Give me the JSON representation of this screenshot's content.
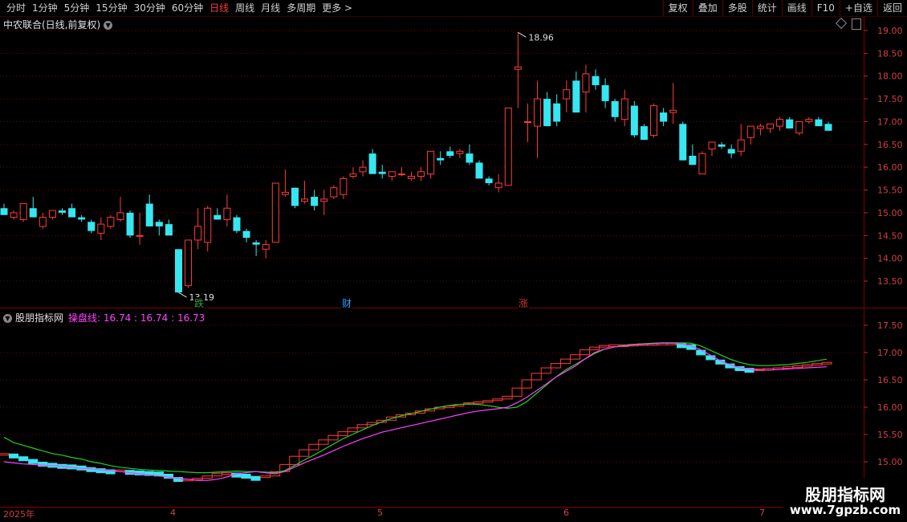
{
  "toolbar": {
    "periods": [
      "分时",
      "1分钟",
      "5分钟",
      "15分钟",
      "30分钟",
      "60分钟",
      "日线",
      "周线",
      "月线",
      "多周期",
      "更多 >"
    ],
    "active_period": "日线",
    "actions": [
      "复权",
      "叠加",
      "多股",
      "统计",
      "画线",
      "F10",
      "+自选",
      "返回"
    ]
  },
  "main_chart": {
    "title": "中农联合(日线,前复权)",
    "price_labels": [
      "19.00",
      "18.50",
      "18.00",
      "17.50",
      "17.00",
      "16.50",
      "16.00",
      "15.50",
      "15.00",
      "14.50",
      "14.00",
      "13.50"
    ],
    "high_label": "18.96",
    "low_label": "13.19",
    "markers": [
      {
        "text": "跌",
        "color": "#3c9c3c"
      },
      {
        "text": "财",
        "color": "#2aa0ff"
      },
      {
        "text": "涨",
        "color": "#d03030"
      }
    ]
  },
  "indicator": {
    "name": "股朋指标网",
    "line_name": "操盘线:",
    "values": "16.74 : 16.74 : 16.73",
    "price_labels": [
      "17.50",
      "17.00",
      "16.50",
      "16.00",
      "15.50",
      "15.00"
    ]
  },
  "date_axis": [
    "2025年",
    "4",
    "5",
    "6",
    "7"
  ],
  "watermark": {
    "line1": "股朋指标网",
    "line2": "www.7gpzb.com"
  },
  "colors": {
    "up": "#ff3b3b",
    "down": "#36e6f0",
    "ma_green": "#20d020",
    "ma_magenta": "#ff40ff",
    "grid": "#7a0000"
  },
  "chart_data": [
    {
      "type": "candlestick",
      "title": "中农联合(日线,前复权)",
      "ylim": [
        13.0,
        19.2
      ],
      "candles": [
        [
          15.1,
          15.2,
          14.95,
          14.95
        ],
        [
          14.9,
          15.05,
          14.85,
          15.0
        ],
        [
          14.85,
          15.2,
          14.8,
          15.2
        ],
        [
          15.1,
          15.35,
          14.9,
          14.9
        ],
        [
          14.7,
          15.0,
          14.65,
          14.9
        ],
        [
          14.9,
          15.05,
          14.85,
          15.05
        ],
        [
          15.05,
          15.1,
          14.95,
          15.0
        ],
        [
          15.1,
          15.2,
          14.95,
          14.9
        ],
        [
          14.9,
          14.95,
          14.8,
          14.85
        ],
        [
          14.8,
          14.85,
          14.55,
          14.6
        ],
        [
          14.55,
          14.9,
          14.4,
          14.75
        ],
        [
          14.7,
          14.95,
          14.65,
          14.9
        ],
        [
          14.85,
          15.35,
          14.8,
          15.0
        ],
        [
          15.0,
          15.05,
          14.45,
          14.5
        ],
        [
          14.5,
          15.0,
          14.3,
          14.5
        ],
        [
          15.2,
          15.4,
          14.8,
          14.7
        ],
        [
          14.8,
          14.85,
          14.5,
          14.7
        ],
        [
          14.75,
          14.85,
          14.55,
          14.5
        ],
        [
          14.2,
          14.2,
          13.25,
          13.25
        ],
        [
          13.4,
          14.4,
          13.35,
          14.4
        ],
        [
          14.4,
          15.1,
          14.2,
          14.7
        ],
        [
          14.35,
          15.15,
          14.15,
          15.1
        ],
        [
          14.95,
          15.1,
          14.85,
          14.85
        ],
        [
          14.85,
          15.4,
          14.7,
          15.1
        ],
        [
          14.9,
          14.95,
          14.55,
          14.6
        ],
        [
          14.6,
          14.65,
          14.35,
          14.45
        ],
        [
          14.35,
          14.4,
          14.05,
          14.3
        ],
        [
          14.2,
          14.4,
          14.0,
          14.3
        ],
        [
          14.35,
          15.6,
          14.35,
          15.65
        ],
        [
          15.4,
          15.95,
          15.35,
          15.45
        ],
        [
          15.55,
          15.55,
          15.1,
          15.15
        ],
        [
          15.25,
          15.7,
          15.2,
          15.3
        ],
        [
          15.35,
          15.5,
          15.05,
          15.15
        ],
        [
          15.25,
          15.5,
          14.95,
          15.3
        ],
        [
          15.35,
          15.6,
          15.3,
          15.55
        ],
        [
          15.4,
          15.8,
          15.3,
          15.75
        ],
        [
          15.8,
          16.0,
          15.75,
          15.85
        ],
        [
          15.9,
          16.15,
          15.8,
          16.0
        ],
        [
          16.3,
          16.4,
          15.9,
          15.85
        ],
        [
          15.9,
          16.05,
          15.75,
          15.85
        ],
        [
          15.8,
          15.9,
          15.7,
          15.9
        ],
        [
          15.85,
          16.0,
          15.8,
          15.85
        ],
        [
          15.75,
          15.9,
          15.7,
          15.8
        ],
        [
          15.8,
          16.0,
          15.7,
          15.9
        ],
        [
          15.85,
          16.15,
          15.75,
          16.35
        ],
        [
          16.2,
          16.35,
          16.05,
          16.15
        ],
        [
          16.35,
          16.45,
          16.2,
          16.25
        ],
        [
          16.3,
          16.4,
          16.2,
          16.35
        ],
        [
          16.3,
          16.5,
          16.05,
          16.1
        ],
        [
          16.1,
          16.15,
          15.8,
          15.75
        ],
        [
          15.75,
          15.8,
          15.6,
          15.65
        ],
        [
          15.55,
          15.85,
          15.45,
          15.65
        ],
        [
          15.6,
          16.8,
          15.6,
          17.3
        ],
        [
          18.15,
          18.96,
          17.3,
          18.2
        ],
        [
          17.0,
          17.4,
          16.55,
          17.0
        ],
        [
          16.9,
          17.9,
          16.2,
          17.5
        ],
        [
          17.5,
          17.65,
          16.9,
          16.9
        ],
        [
          17.4,
          17.6,
          16.9,
          17.0
        ],
        [
          17.5,
          17.9,
          17.2,
          17.7
        ],
        [
          17.9,
          18.1,
          17.3,
          17.2
        ],
        [
          17.65,
          18.25,
          17.2,
          18.05
        ],
        [
          18.0,
          18.15,
          17.7,
          17.8
        ],
        [
          17.8,
          17.95,
          17.3,
          17.45
        ],
        [
          17.45,
          17.5,
          17.0,
          17.1
        ],
        [
          17.05,
          17.7,
          16.9,
          17.5
        ],
        [
          17.35,
          17.45,
          16.65,
          16.7
        ],
        [
          16.9,
          16.95,
          16.6,
          16.6
        ],
        [
          16.7,
          17.4,
          16.65,
          17.35
        ],
        [
          17.2,
          17.3,
          16.9,
          17.0
        ],
        [
          17.2,
          17.85,
          16.95,
          17.25
        ],
        [
          16.95,
          17.0,
          16.35,
          16.15
        ],
        [
          16.25,
          16.5,
          16.05,
          16.05
        ],
        [
          15.85,
          16.35,
          15.85,
          16.3
        ],
        [
          16.4,
          16.45,
          16.25,
          16.55
        ],
        [
          16.5,
          16.55,
          16.4,
          16.45
        ],
        [
          16.4,
          16.5,
          16.2,
          16.3
        ],
        [
          16.35,
          16.95,
          16.25,
          16.6
        ],
        [
          16.65,
          16.9,
          16.5,
          16.9
        ],
        [
          16.85,
          16.95,
          16.7,
          16.9
        ],
        [
          16.85,
          16.95,
          16.75,
          16.95
        ],
        [
          16.9,
          17.1,
          16.8,
          17.05
        ],
        [
          17.05,
          17.1,
          16.85,
          16.85
        ],
        [
          16.75,
          17.0,
          16.7,
          17.0
        ],
        [
          17.0,
          17.1,
          16.95,
          17.05
        ],
        [
          17.05,
          17.1,
          16.9,
          16.9
        ],
        [
          16.95,
          17.0,
          16.8,
          16.8
        ]
      ]
    },
    {
      "type": "line",
      "title": "操盘线",
      "ylim": [
        14.6,
        17.75
      ],
      "series": [
        {
          "values": [
            15.15,
            15.1,
            15.05,
            15.0,
            14.98,
            14.96,
            14.95,
            14.93,
            14.9,
            14.88,
            14.86,
            14.85,
            14.85,
            14.84,
            14.83,
            14.82,
            14.78,
            14.72,
            14.68,
            14.68,
            14.7,
            14.74,
            14.79,
            14.8,
            14.78,
            14.74,
            14.72,
            14.74,
            14.82,
            14.95,
            15.1,
            15.22,
            15.32,
            15.4,
            15.48,
            15.55,
            15.62,
            15.68,
            15.72,
            15.76,
            15.82,
            15.86,
            15.89,
            15.93,
            15.97,
            16.0,
            16.02,
            16.05,
            16.08,
            16.1,
            16.12,
            16.15,
            16.2,
            16.35,
            16.5,
            16.62,
            16.72,
            16.8,
            16.88,
            16.96,
            17.05,
            17.1,
            17.13,
            17.14,
            17.14,
            17.15,
            17.16,
            17.16,
            17.17,
            17.17,
            17.15,
            17.05,
            16.95,
            16.87,
            16.8,
            16.75,
            16.72,
            16.7,
            16.7,
            16.71,
            16.72,
            16.74,
            16.76,
            16.78,
            16.8,
            16.82
          ]
        },
        {
          "values": [
            15.0,
            14.98,
            14.96,
            14.95,
            14.94,
            14.93,
            14.92,
            14.9,
            14.88,
            14.87,
            14.85,
            14.84,
            14.82,
            14.8,
            14.78,
            14.76,
            14.74,
            14.72,
            14.7,
            14.68,
            14.66,
            14.66,
            14.68,
            14.72,
            14.78,
            14.8,
            14.82,
            14.8,
            14.78,
            14.82,
            14.9,
            14.98,
            15.05,
            15.12,
            15.2,
            15.28,
            15.35,
            15.42,
            15.48,
            15.54,
            15.58,
            15.62,
            15.66,
            15.7,
            15.74,
            15.78,
            15.82,
            15.86,
            15.9,
            15.93,
            15.95,
            15.97,
            16.0,
            16.08,
            16.18,
            16.3,
            16.42,
            16.55,
            16.65,
            16.75,
            16.88,
            17.0,
            17.06,
            17.1,
            17.12,
            17.14,
            17.15,
            17.16,
            17.17,
            17.17,
            17.16,
            17.12,
            17.05,
            16.95,
            16.85,
            16.78,
            16.72,
            16.7,
            16.68,
            16.68,
            16.69,
            16.7,
            16.71,
            16.72,
            16.73,
            16.74
          ]
        },
        {
          "values": [
            15.45,
            15.35,
            15.3,
            15.25,
            15.2,
            15.15,
            15.12,
            15.08,
            15.05,
            15.0,
            14.97,
            14.93,
            14.9,
            14.88,
            14.86,
            14.85,
            14.84,
            14.83,
            14.82,
            14.81,
            14.8,
            14.8,
            14.81,
            14.82,
            14.83,
            14.82,
            14.82,
            14.81,
            14.8,
            14.84,
            14.93,
            15.03,
            15.12,
            15.22,
            15.32,
            15.42,
            15.5,
            15.58,
            15.66,
            15.73,
            15.79,
            15.84,
            15.88,
            15.92,
            15.96,
            16.0,
            16.03,
            16.05,
            16.06,
            16.05,
            16.03,
            16.0,
            15.98,
            16.0,
            16.1,
            16.25,
            16.4,
            16.55,
            16.68,
            16.78,
            16.88,
            16.98,
            17.06,
            17.1,
            17.13,
            17.15,
            17.16,
            17.17,
            17.18,
            17.18,
            17.18,
            17.17,
            17.12,
            17.04,
            16.96,
            16.88,
            16.82,
            16.78,
            16.76,
            16.76,
            16.77,
            16.78,
            16.8,
            16.82,
            16.85,
            16.88
          ]
        }
      ]
    }
  ]
}
